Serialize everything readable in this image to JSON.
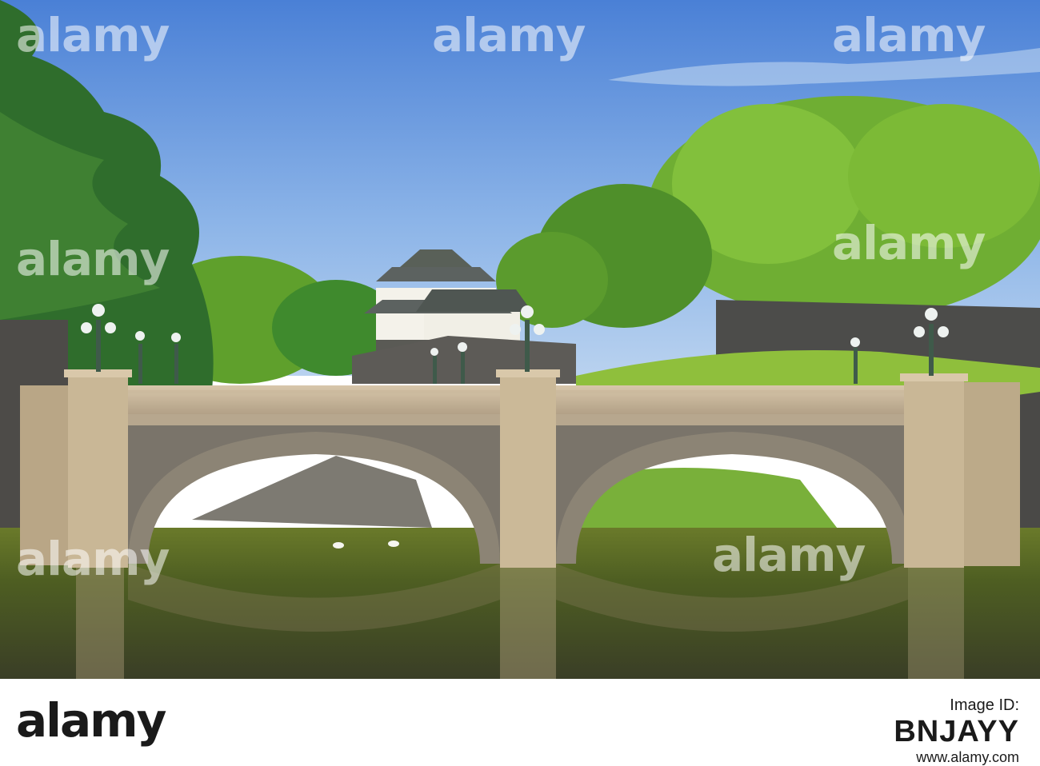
{
  "image": {
    "subject": "stone-double-arch-bridge-over-moat-with-castle-keep",
    "colors": {
      "sky_top": "#4f86d8",
      "sky_bottom": "#9cc0ea",
      "foliage_dark": "#2e6b2a",
      "foliage_light": "#8fc63c",
      "stone": "#c9b59a",
      "stone_dark": "#6f6a63",
      "water": "#4f5a2a"
    }
  },
  "watermark": {
    "text": "alamy"
  },
  "footer": {
    "logo_text": "alamy",
    "label": "Image ID:",
    "image_id": "BNJAYY",
    "url": "www.alamy.com"
  }
}
